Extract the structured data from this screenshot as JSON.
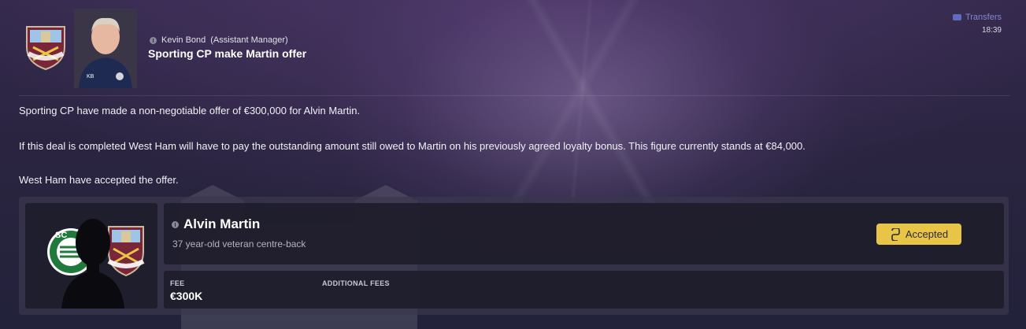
{
  "header": {
    "sender_name": "Kevin Bond",
    "sender_role": "(Assistant Manager)",
    "subject": "Sporting CP make Martin offer",
    "category": "Transfers",
    "time": "18:39",
    "crest_text": "WEST HAM UNITED",
    "portrait_initials": "KB"
  },
  "body": {
    "paragraph_1": "Sporting CP have made a non-negotiable offer of €300,000 for Alvin Martin.",
    "paragraph_2": "If this deal is completed West Ham will have to pay the outstanding amount still owed to Martin on his previously agreed loyalty bonus. This figure currently stands at €84,000.",
    "paragraph_3": "West Ham have accepted the offer."
  },
  "offer_card": {
    "player_name": "Alvin Martin",
    "player_description": "37 year-old veteran centre-back",
    "status": "Accepted",
    "fee_label": "FEE",
    "fee_value": "€300K",
    "additional_fees_label": "ADDITIONAL FEES",
    "from_club_crest_text": "SPORTING PORTUGAL",
    "to_club_crest_text": "WEST HAM UNITED"
  },
  "colors": {
    "accent_status": "#e8c547",
    "category_blue": "#7d8ad2",
    "west_ham_claret": "#7a2639",
    "sporting_green": "#1f7a3c"
  },
  "icons": {
    "sender_info": "info-icon",
    "category": "transfer-tag-icon",
    "status": "handshake-icon"
  }
}
